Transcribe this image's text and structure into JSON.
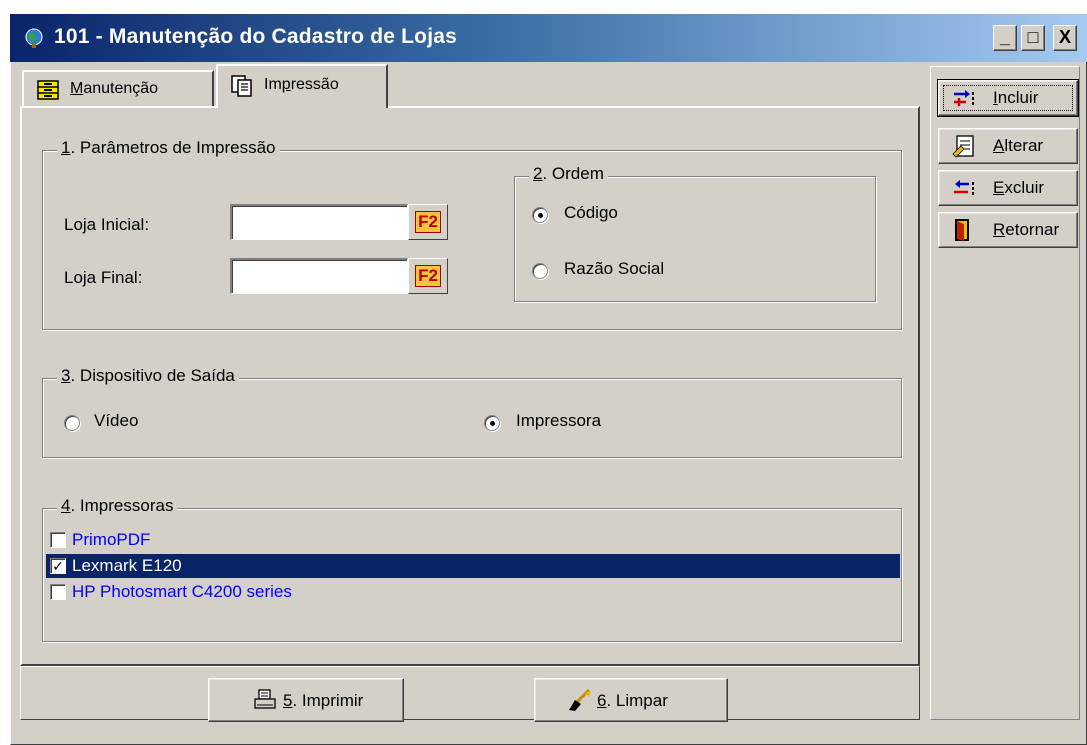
{
  "window": {
    "title": "101 - Manutenção do Cadastro de Lojas",
    "controls": {
      "minimize": "_",
      "maximize": "□",
      "close": "X"
    }
  },
  "tabs": [
    {
      "label_u": "M",
      "label_rest": "anutenção",
      "icon": "database-icon",
      "active": false
    },
    {
      "label_pre": "Im",
      "label_u": "p",
      "label_rest": "ressão",
      "icon": "print-pages-icon",
      "active": true
    }
  ],
  "params": {
    "legend_u": "1",
    "legend_rest": ". Parâmetros de Impressão",
    "loja_inicial": {
      "label": "Loja Inicial:",
      "value": "",
      "lookup": "F2"
    },
    "loja_final": {
      "label": "Loja Final:",
      "value": "",
      "lookup": "F2"
    }
  },
  "ordem": {
    "legend_u": "2",
    "legend_rest": ". Ordem",
    "options": [
      {
        "label": "Código",
        "checked": true
      },
      {
        "label": "Razão Social",
        "checked": false
      }
    ]
  },
  "saida": {
    "legend_u": "3",
    "legend_rest": ". Dispositivo de Saída",
    "options": [
      {
        "label": "Vídeo",
        "checked": false
      },
      {
        "label": "Impressora",
        "checked": true
      }
    ]
  },
  "impressoras": {
    "legend_u": "4",
    "legend_rest": ". Impressoras",
    "items": [
      {
        "name": "PrimoPDF",
        "checked": false,
        "selected": false
      },
      {
        "name": "Lexmark E120",
        "checked": true,
        "selected": true
      },
      {
        "name": "HP Photosmart C4200 series",
        "checked": false,
        "selected": false
      }
    ]
  },
  "actions": {
    "imprimir": {
      "label_u": "5",
      "label_rest": ". Imprimir"
    },
    "limpar": {
      "label_u": "6",
      "label_rest": ". Limpar"
    }
  },
  "toolbar": {
    "incluir": {
      "label_u": "I",
      "label_rest": "ncluir"
    },
    "alterar": {
      "label_u": "A",
      "label_rest": "lterar"
    },
    "excluir": {
      "label_u": "E",
      "label_rest": "xcluir"
    },
    "retornar": {
      "label_u": "R",
      "label_rest": "etornar"
    }
  },
  "colors": {
    "titlebar_start": "#0a246a",
    "titlebar_end": "#a6caf0",
    "face": "#d4d0c8",
    "list_text": "#0000ff",
    "selection": "#0a246a"
  }
}
